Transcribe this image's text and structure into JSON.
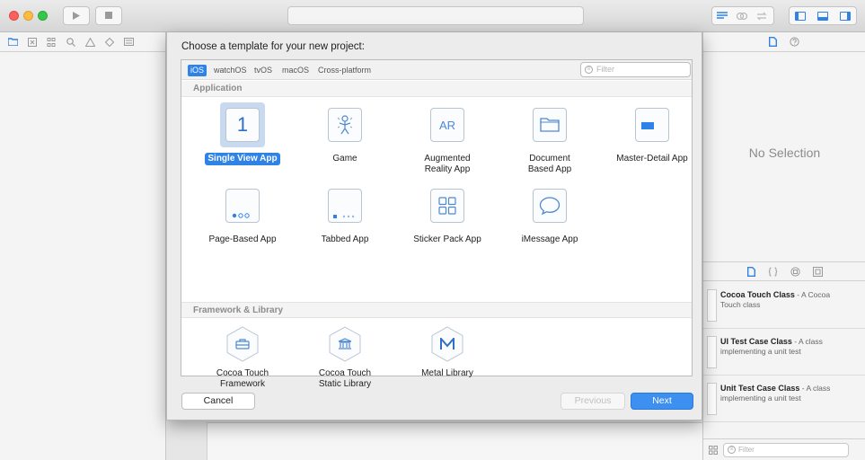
{
  "toolbar": {
    "play_icon": "play-icon",
    "stop_icon": "stop-icon"
  },
  "navigator": {
    "tabs": [
      "folder-icon",
      "warning-box-icon",
      "hierarchy-icon",
      "search-icon",
      "warning-icon",
      "test-icon",
      "debug-icon"
    ]
  },
  "sheet": {
    "title": "Choose a template for your new project:",
    "platforms": [
      "iOS",
      "watchOS",
      "tvOS",
      "macOS",
      "Cross-platform"
    ],
    "filter_placeholder": "Filter",
    "sections": {
      "application": "Application",
      "framework": "Framework & Library"
    },
    "application_templates": [
      {
        "label": "Single View App",
        "icon": "number-one-icon",
        "selected": true
      },
      {
        "label": "Game",
        "icon": "game-icon"
      },
      {
        "label": "Augmented\nReality App",
        "icon": "ar-icon"
      },
      {
        "label": "Document\nBased App",
        "icon": "document-icon"
      },
      {
        "label": "Master-Detail App",
        "icon": "master-detail-icon"
      },
      {
        "label": "Page-Based App",
        "icon": "page-dots-icon"
      },
      {
        "label": "Tabbed App",
        "icon": "tab-bar-icon"
      },
      {
        "label": "Sticker Pack App",
        "icon": "sticker-grid-icon"
      },
      {
        "label": "iMessage App",
        "icon": "message-bubble-icon"
      }
    ],
    "framework_templates": [
      {
        "label": "Cocoa Touch\nFramework",
        "icon": "toolbox-icon"
      },
      {
        "label": "Cocoa Touch\nStatic Library",
        "icon": "library-building-icon"
      },
      {
        "label": "Metal Library",
        "icon": "metal-icon"
      }
    ],
    "buttons": {
      "cancel": "Cancel",
      "previous": "Previous",
      "next": "Next"
    }
  },
  "inspector": {
    "no_selection": "No Selection"
  },
  "library": {
    "items": [
      {
        "name": "Cocoa Touch Class",
        "desc_inline": " - A Cocoa",
        "desc": "Touch class"
      },
      {
        "name": "UI Test Case Class",
        "desc_inline": " - A class",
        "desc": "implementing a unit test"
      },
      {
        "name": "Unit Test Case Class",
        "desc_inline": " - A class",
        "desc": "implementing a unit test"
      }
    ],
    "filter_placeholder": "Filter"
  },
  "colors": {
    "accent": "#2f82e6",
    "selected_tile_bg": "#c9daf0",
    "close": "#fc605c",
    "minimize": "#fdbc40",
    "zoom": "#34c84a"
  }
}
